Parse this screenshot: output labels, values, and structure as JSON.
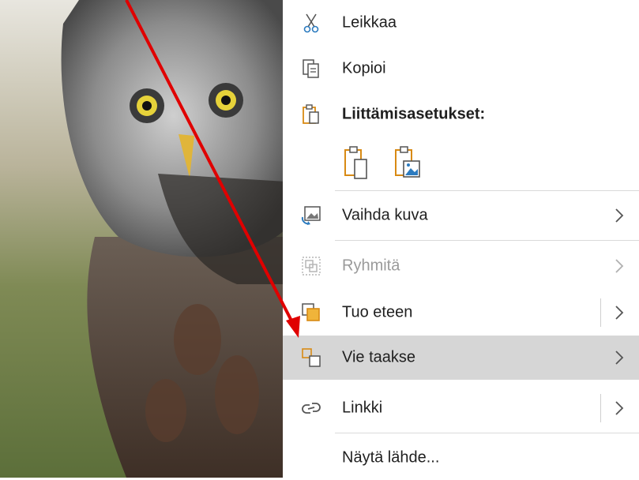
{
  "menu": {
    "cut": {
      "label": "Leikkaa",
      "icon": "scissors-icon"
    },
    "copy": {
      "label": "Kopioi",
      "icon": "copy-icon"
    },
    "paste_header": {
      "label": "Liittämisasetukset:",
      "icon": "clipboard-icon"
    },
    "paste_options": [
      {
        "icon": "paste-keep-formatting-icon"
      },
      {
        "icon": "paste-as-picture-icon"
      }
    ],
    "change_picture": {
      "label": "Vaihda kuva",
      "icon": "change-picture-icon",
      "submenu": true
    },
    "group": {
      "label": "Ryhmitä",
      "icon": "group-icon",
      "disabled": true,
      "submenu": true
    },
    "bring_forward": {
      "label": "Tuo eteen",
      "icon": "bring-forward-icon",
      "submenu": true
    },
    "send_backward": {
      "label": "Vie taakse",
      "icon": "send-backward-icon",
      "submenu": true,
      "highlighted": true
    },
    "link": {
      "label": "Linkki",
      "icon": "link-icon",
      "submenu": true
    },
    "view_source": {
      "label": "Näytä lähde..."
    }
  },
  "colors": {
    "accent_orange": "#d88a14",
    "highlight": "#d6d6d6",
    "arrow": "#e00000",
    "text": "#1f1f1f",
    "disabled": "#9a9a9a"
  }
}
